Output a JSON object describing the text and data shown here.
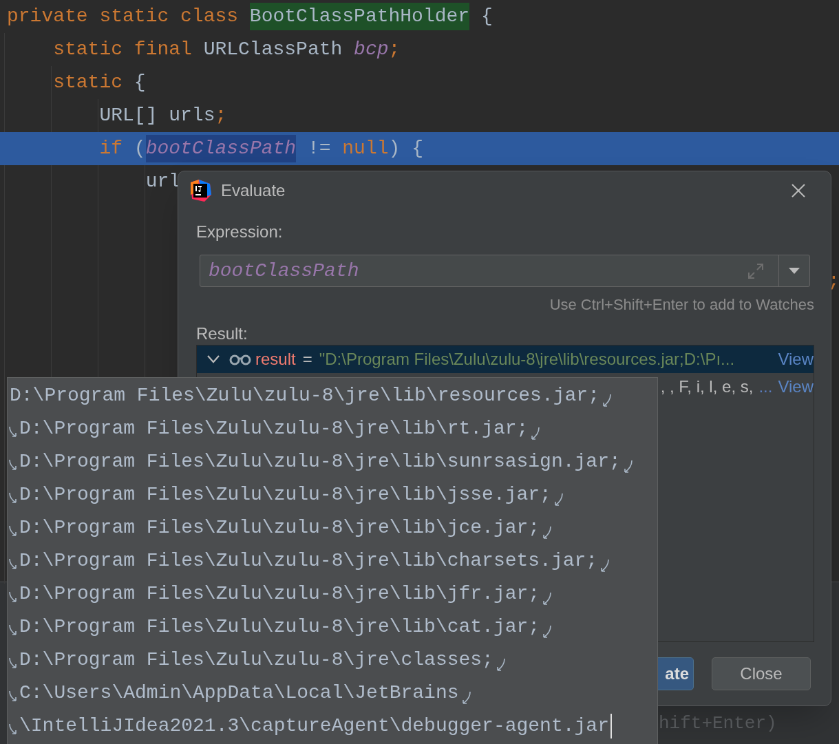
{
  "editor": {
    "lines": [
      {
        "selected": false,
        "tokens": [
          {
            "text": "private static class ",
            "kind": "keyword"
          },
          {
            "text": "BootClassPathHolder",
            "kind": "highlight"
          },
          {
            "text": " {",
            "kind": "plain"
          }
        ]
      },
      {
        "selected": false,
        "tokens": [
          {
            "text": "    static final ",
            "kind": "keyword"
          },
          {
            "text": "URLClassPath ",
            "kind": "plain"
          },
          {
            "text": "bcp",
            "kind": "field"
          },
          {
            "text": ";",
            "kind": "keyword"
          }
        ]
      },
      {
        "selected": false,
        "tokens": [
          {
            "text": "    static ",
            "kind": "keyword"
          },
          {
            "text": "{",
            "kind": "plain"
          }
        ]
      },
      {
        "selected": false,
        "tokens": [
          {
            "text": "        URL[] urls",
            "kind": "plain"
          },
          {
            "text": ";",
            "kind": "keyword"
          }
        ]
      },
      {
        "selected": true,
        "tokens": [
          {
            "text": "        if ",
            "kind": "keyword"
          },
          {
            "text": "(",
            "kind": "plain"
          },
          {
            "text": "bootClassPath",
            "kind": "field-match"
          },
          {
            "text": " != ",
            "kind": "plain"
          },
          {
            "text": "null",
            "kind": "keyword"
          },
          {
            "text": ") {",
            "kind": "plain"
          }
        ]
      },
      {
        "selected": false,
        "tokens": [
          {
            "text": "            url",
            "kind": "plain"
          }
        ]
      }
    ],
    "right_fragment": ";",
    "bottom_hint": "hift+Enter)"
  },
  "dialog": {
    "title": "Evaluate",
    "expression_label": "Expression:",
    "expression": "bootClassPath",
    "hint": "Use Ctrl+Shift+Enter to add to Watches",
    "result_label": "Result:",
    "result_rows": [
      {
        "selected": true,
        "expanded": true,
        "name": "result",
        "equals": "=",
        "value": "\"D:\\Program Files\\Zulu\\zulu-8\\jre\\lib\\resources.jar;D:\\Pı...",
        "link": "View"
      },
      {
        "selected": false,
        "value": ", , F, i, l, e, s,",
        "ellipsis": "...",
        "link": "View"
      }
    ],
    "buttons": [
      {
        "label": "ate",
        "kind": "primary"
      },
      {
        "label": "Close",
        "kind": "default"
      }
    ]
  },
  "popup": {
    "lines": [
      "D:\\Program Files\\Zulu\\zulu-8\\jre\\lib\\resources.jar;",
      "D:\\Program Files\\Zulu\\zulu-8\\jre\\lib\\rt.jar;",
      "D:\\Program Files\\Zulu\\zulu-8\\jre\\lib\\sunrsasign.jar;",
      "D:\\Program Files\\Zulu\\zulu-8\\jre\\lib\\jsse.jar;",
      "D:\\Program Files\\Zulu\\zulu-8\\jre\\lib\\jce.jar;",
      "D:\\Program Files\\Zulu\\zulu-8\\jre\\lib\\charsets.jar;",
      "D:\\Program Files\\Zulu\\zulu-8\\jre\\lib\\jfr.jar;",
      "D:\\Program Files\\Zulu\\zulu-8\\jre\\lib\\cat.jar;",
      "D:\\Program Files\\Zulu\\zulu-8\\jre\\classes;",
      "C:\\Users\\Admin\\AppData\\Local\\JetBrains",
      "\\IntelliJIdea2021.3\\captureAgent\\debugger-agent.jar"
    ]
  }
}
